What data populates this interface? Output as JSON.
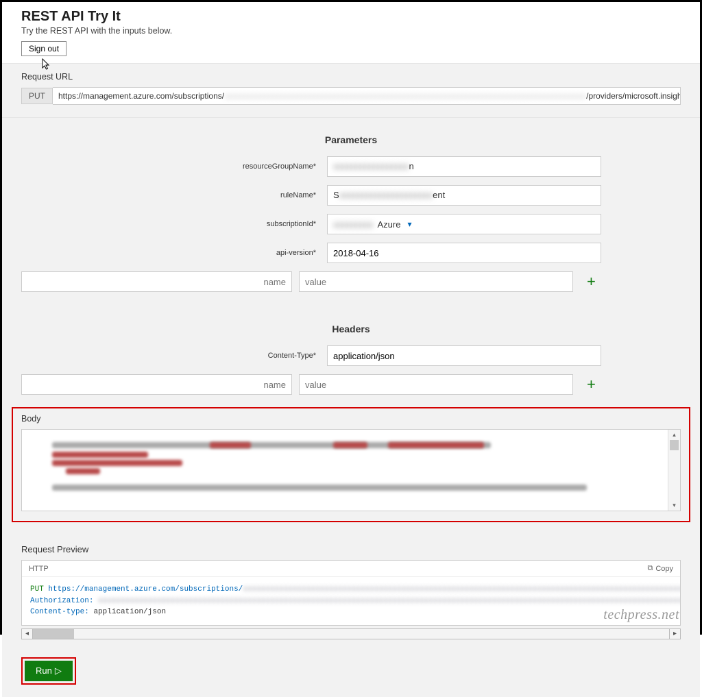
{
  "header": {
    "title": "REST API Try It",
    "subtitle": "Try the REST API with the inputs below.",
    "signout": "Sign out"
  },
  "request": {
    "section_label": "Request URL",
    "method": "PUT",
    "url_prefix": "https://management.azure.com/subscriptions/",
    "url_mid": "/providers/microsoft.insights/scheduledQueryRules/"
  },
  "parameters": {
    "title": "Parameters",
    "rows": [
      {
        "label": "resourceGroupName*",
        "value_obscured": true,
        "suffix": "n"
      },
      {
        "label": "ruleName*",
        "value_prefix": "S",
        "value_obscured": true,
        "suffix": "ent"
      },
      {
        "label": "subscriptionId*",
        "is_select": true,
        "suffix": "Azure"
      },
      {
        "label": "api-version*",
        "value": "2018-04-16"
      }
    ],
    "add": {
      "name_placeholder": "name",
      "value_placeholder": "value"
    }
  },
  "headers": {
    "title": "Headers",
    "rows": [
      {
        "label": "Content-Type*",
        "value": "application/json"
      }
    ],
    "add": {
      "name_placeholder": "name",
      "value_placeholder": "value"
    }
  },
  "body": {
    "title": "Body"
  },
  "preview": {
    "title": "Request Preview",
    "tab": "HTTP",
    "copy": "Copy",
    "line1_method": "PUT",
    "line1_url": "https://management.azure.com/subscriptions/",
    "line2_key": "Authorization:",
    "line3_key": "Content-type:",
    "line3_val": "application/json"
  },
  "run": {
    "label": "Run"
  },
  "watermark": "techpress.net"
}
